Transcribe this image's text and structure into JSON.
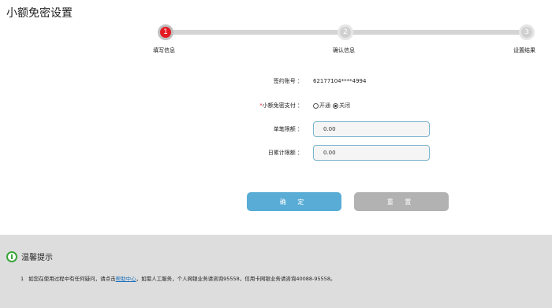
{
  "page": {
    "title": "小额免密设置"
  },
  "stepper": {
    "steps": [
      {
        "number": "1",
        "label": "填写信息",
        "active": true
      },
      {
        "number": "2",
        "label": "确认信息",
        "active": false
      },
      {
        "number": "3",
        "label": "设置结果",
        "active": false
      }
    ],
    "active_color": "#e31b23"
  },
  "form": {
    "account": {
      "label": "签约账号 ：",
      "value": "62177104****4994"
    },
    "payment": {
      "required_mark": "*",
      "label": "小额免密支付 ：",
      "options": [
        {
          "label": "开通",
          "checked": false
        },
        {
          "label": "关闭",
          "checked": true
        }
      ]
    },
    "single_limit": {
      "label": "单笔限额 ：",
      "value": "0.00"
    },
    "daily_limit": {
      "label": "日累计限额 ：",
      "value": "0.00"
    }
  },
  "buttons": {
    "confirm_label": "确 定",
    "reset_label": "重 置",
    "confirm_color": "#58acd6",
    "reset_color": "#b2b2b2"
  },
  "tips": {
    "title": "温馨提示",
    "icon": "info-circle-icon",
    "number": "1",
    "text_before": "如您在使用过程中有任何疑问，请点击",
    "link_text": "帮助中心",
    "text_after": "，如需人工服务，个人网银业务请咨询95558，信用卡网银业务请咨询40088-95558。"
  }
}
